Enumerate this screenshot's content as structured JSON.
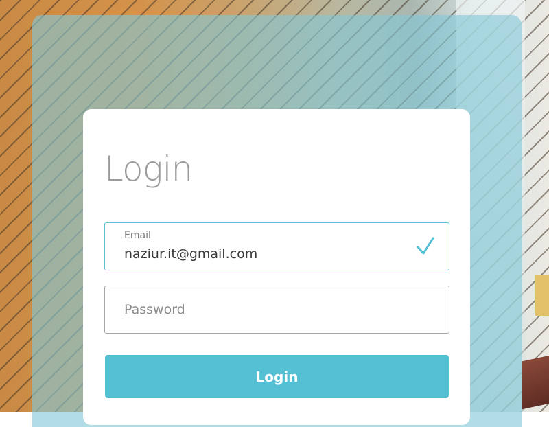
{
  "login": {
    "title": "Login",
    "email": {
      "label": "Email",
      "value": "naziur.it@gmail.com",
      "valid_icon": "check-icon"
    },
    "password": {
      "placeholder": "Password"
    },
    "submit_label": "Login"
  },
  "colors": {
    "accent": "#55bfd4",
    "overlay": "#82c8d7",
    "title_text": "#9a9a9a"
  }
}
